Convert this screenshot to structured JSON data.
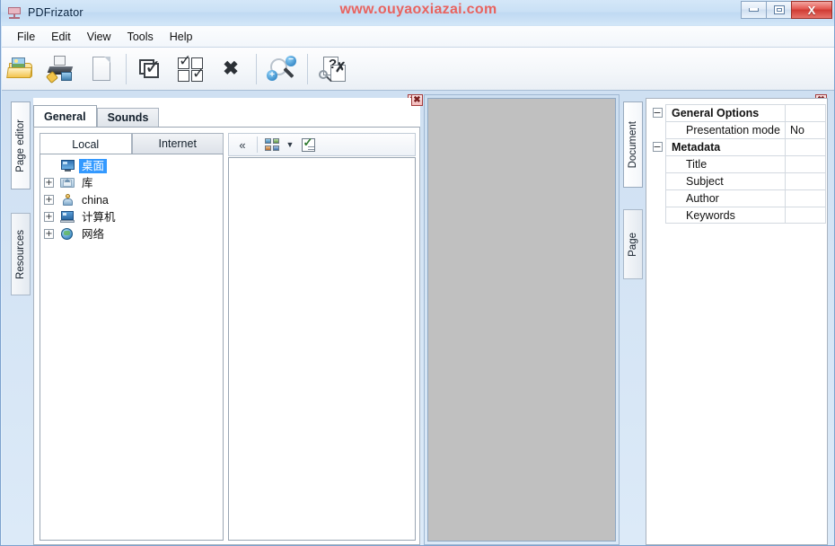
{
  "window": {
    "title": "PDFrizator",
    "app_icon": "projector-icon",
    "watermark": "www.ouyaoxiazai.com",
    "watermark_color": "#e8635f",
    "controls": {
      "minimize": "minimize-icon",
      "maximize": "maximize-icon",
      "close": "X"
    }
  },
  "menubar": {
    "items": [
      {
        "label": "File"
      },
      {
        "label": "Edit"
      },
      {
        "label": "View"
      },
      {
        "label": "Tools"
      },
      {
        "label": "Help"
      }
    ]
  },
  "toolbar": {
    "buttons": [
      {
        "name": "open-folder",
        "icon": "open-folder-icon"
      },
      {
        "name": "import-scanner",
        "icon": "scanner-import-icon"
      },
      {
        "name": "new-page",
        "icon": "blank-page-icon"
      },
      {
        "name": "select-all",
        "icon": "select-all-icon"
      },
      {
        "name": "invert-selection",
        "icon": "invert-selection-icon"
      },
      {
        "name": "delete",
        "icon": "delete-x-icon",
        "glyph": "✖"
      },
      {
        "name": "zoom",
        "icon": "zoom-in-out-icon",
        "plus": "+",
        "minus": "−"
      },
      {
        "name": "page-preview",
        "icon": "page-search-icon"
      }
    ]
  },
  "left_panel": {
    "close_label": "✖",
    "vertical_tabs": [
      {
        "label": "Page editor",
        "active": true
      },
      {
        "label": "Resources",
        "active": false
      }
    ],
    "tabs": [
      {
        "label": "General",
        "active": true
      },
      {
        "label": "Sounds",
        "active": false
      }
    ],
    "subtabs": [
      {
        "label": "Local",
        "active": true
      },
      {
        "label": "Internet",
        "active": false
      }
    ],
    "tree": [
      {
        "label": "桌面",
        "icon": "desktop-icon",
        "expandable": false,
        "selected": true
      },
      {
        "label": "库",
        "icon": "library-icon",
        "expandable": true,
        "selected": false
      },
      {
        "label": "china",
        "icon": "user-folder-icon",
        "expandable": true,
        "selected": false
      },
      {
        "label": "计算机",
        "icon": "computer-icon",
        "expandable": true,
        "selected": false
      },
      {
        "label": "网络",
        "icon": "network-globe-icon",
        "expandable": true,
        "selected": false
      }
    ],
    "expander_glyph": "+",
    "file_toolbar": {
      "collapse_label": "«",
      "thumbnails_icon": "thumbnails-view-icon",
      "dropdown_glyph": "▼",
      "checklist_icon": "checklist-icon"
    }
  },
  "center_panel": {
    "close_label": "✖",
    "canvas_color": "#c0c0c0"
  },
  "right_panel": {
    "close_label": "✖",
    "vertical_tabs": [
      {
        "label": "Document",
        "active": true
      },
      {
        "label": "Page",
        "active": false
      }
    ],
    "properties": [
      {
        "type": "group",
        "name": "General Options",
        "value": "",
        "expander": "−"
      },
      {
        "type": "child",
        "name": "Presentation mode",
        "value": "No"
      },
      {
        "type": "group",
        "name": "Metadata",
        "value": "",
        "expander": "−"
      },
      {
        "type": "child",
        "name": "Title",
        "value": ""
      },
      {
        "type": "child",
        "name": "Subject",
        "value": ""
      },
      {
        "type": "child",
        "name": "Author",
        "value": ""
      },
      {
        "type": "child",
        "name": "Keywords",
        "value": ""
      }
    ]
  }
}
